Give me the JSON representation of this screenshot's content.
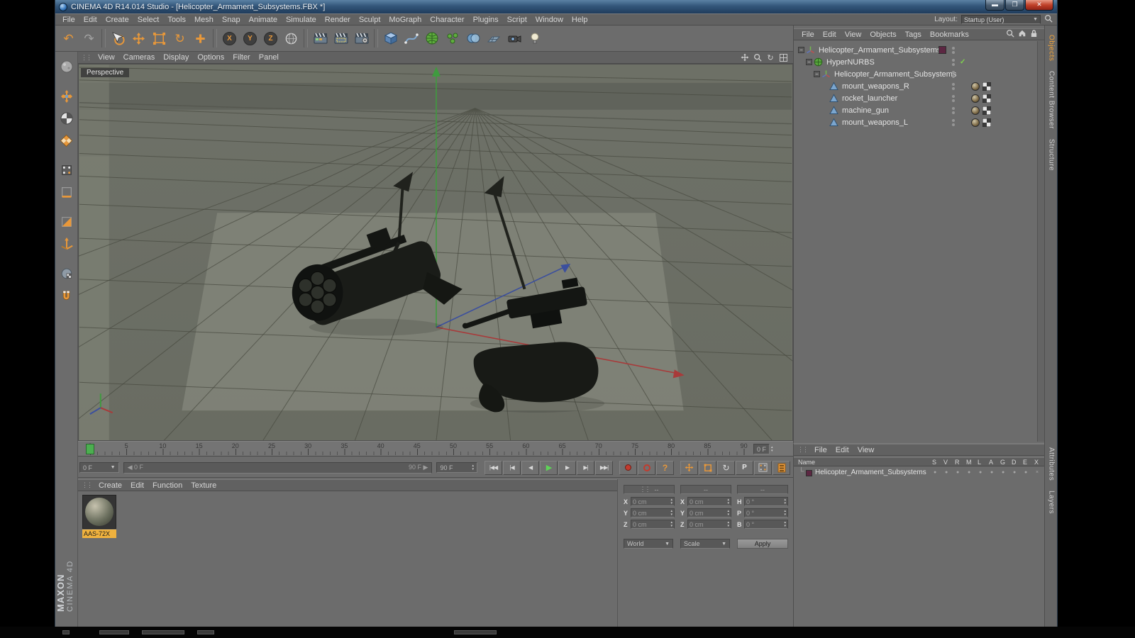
{
  "colors": {
    "accent_orange": "#e8983a",
    "axis_green": "#3f9b3f",
    "axis_red": "#a83a3a",
    "axis_blue": "#3b4f9e",
    "layer_color": "#5c2742",
    "selection_highlight": "#f0b23e"
  },
  "window": {
    "title": "CINEMA 4D R14.014 Studio - [Helicopter_Armament_Subsystems.FBX *]"
  },
  "menubar": {
    "items": [
      "File",
      "Edit",
      "Create",
      "Select",
      "Tools",
      "Mesh",
      "Snap",
      "Animate",
      "Simulate",
      "Render",
      "Sculpt",
      "MoGraph",
      "Character",
      "Plugins",
      "Script",
      "Window",
      "Help"
    ],
    "layout_label": "Layout:",
    "layout_value": "Startup (User)"
  },
  "toolbar": {
    "axis_labels": [
      "X",
      "Y",
      "Z"
    ]
  },
  "viewport": {
    "menu": [
      "View",
      "Cameras",
      "Display",
      "Options",
      "Filter",
      "Panel"
    ],
    "view_label": "Perspective"
  },
  "objects_panel": {
    "menu": [
      "File",
      "Edit",
      "View",
      "Objects",
      "Tags",
      "Bookmarks"
    ],
    "tree": [
      {
        "label": "Helicopter_Armament_Subsystems",
        "depth": 0,
        "icon": "null-object",
        "expandable": true,
        "chip": "#5c2742"
      },
      {
        "label": "HyperNURBS",
        "depth": 1,
        "icon": "hypernurbs",
        "expandable": true,
        "check": true
      },
      {
        "label": "Helicopter_Armament_Subsystems",
        "depth": 2,
        "icon": "null-object",
        "expandable": true
      },
      {
        "label": "mount_weapons_R",
        "depth": 3,
        "icon": "polygon-object",
        "tags": true
      },
      {
        "label": "rocket_launcher",
        "depth": 3,
        "icon": "polygon-object",
        "tags": true
      },
      {
        "label": "machine_gun",
        "depth": 3,
        "icon": "polygon-object",
        "tags": true
      },
      {
        "label": "mount_weapons_L",
        "depth": 3,
        "icon": "polygon-object",
        "tags": true
      }
    ]
  },
  "timeline": {
    "ticks": [
      "0",
      "5",
      "10",
      "15",
      "20",
      "25",
      "30",
      "35",
      "40",
      "45",
      "50",
      "55",
      "60",
      "65",
      "70",
      "75",
      "80",
      "85",
      "90"
    ],
    "frame_field": "0 F"
  },
  "transport": {
    "frame_menu": "0 F",
    "range_start": "0 F",
    "range_end": "90 F",
    "end_field": "90 F",
    "parameter_label": "P"
  },
  "materials_panel": {
    "menu": [
      "Create",
      "Edit",
      "Function",
      "Texture"
    ],
    "materials": [
      {
        "name": "AAS-72X"
      }
    ]
  },
  "coords_panel": {
    "headers": [
      "--",
      "--",
      "--"
    ],
    "col1": {
      "labels": [
        "X",
        "Y",
        "Z"
      ],
      "values": [
        "0 cm",
        "0 cm",
        "0 cm"
      ]
    },
    "col2": {
      "labels": [
        "X",
        "Y",
        "Z"
      ],
      "values": [
        "0 cm",
        "0 cm",
        "0 cm"
      ]
    },
    "col3": {
      "labels": [
        "H",
        "P",
        "B"
      ],
      "values": [
        "0 °",
        "0 °",
        "0 °"
      ]
    },
    "world": "World",
    "scale": "Scale",
    "apply": "Apply"
  },
  "layers_panel": {
    "menu": [
      "File",
      "Edit",
      "View"
    ],
    "name_header": "Name",
    "columns": [
      "S",
      "V",
      "R",
      "M",
      "L",
      "A",
      "G",
      "D",
      "E",
      "X"
    ],
    "rows": [
      {
        "label": "Helicopter_Armament_Subsystems",
        "color": "#5c2742"
      }
    ]
  },
  "right_tabs": {
    "top": [
      "Objects",
      "Content Browser",
      "Structure"
    ],
    "bottom": [
      "Attributes",
      "Layers"
    ],
    "active": "Objects"
  },
  "branding": {
    "maxon": "MAXON",
    "cinema": "CINEMA 4D"
  }
}
